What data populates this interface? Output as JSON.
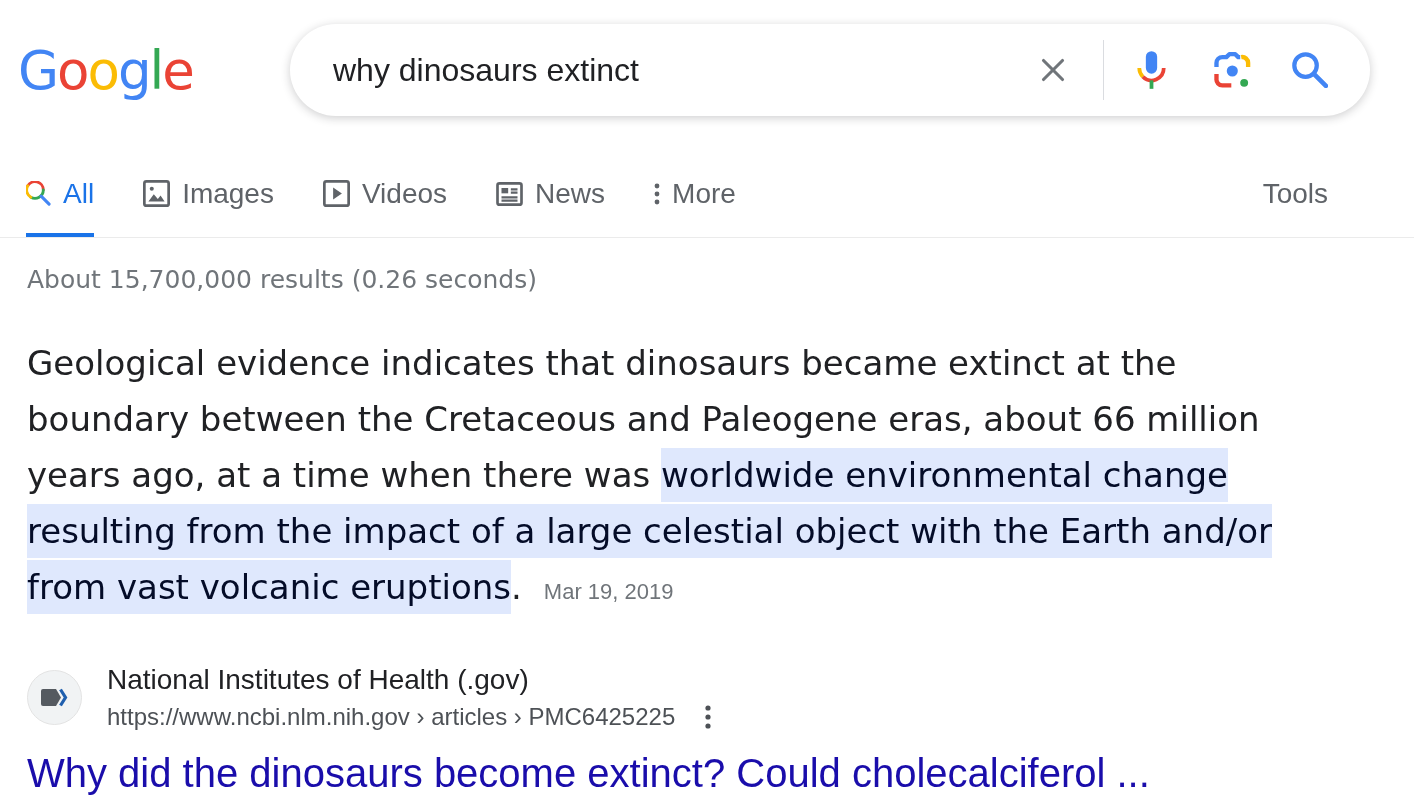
{
  "logo": {
    "text": "Google"
  },
  "search": {
    "value": "why dinosaurs extinct"
  },
  "tabs": [
    {
      "label": "All",
      "selected": true
    },
    {
      "label": "Images",
      "selected": false
    },
    {
      "label": "Videos",
      "selected": false
    },
    {
      "label": "News",
      "selected": false
    },
    {
      "label": "More",
      "selected": false
    }
  ],
  "tools": {
    "label": "Tools"
  },
  "result_stats": "About 15,700,000 results (0.26 seconds)",
  "featured_snippet": {
    "segments": [
      {
        "text": "Geological evidence indicates that dinosaurs became extinct at the boundary between the Cretaceous and Paleogene eras, about 66 million years ago, at a time when there was ",
        "highlighted": false
      },
      {
        "text": "worldwide environmental change resulting from the impact of a large celestial object with the Earth and/or from vast volcanic eruptions",
        "highlighted": true
      },
      {
        "text": ".",
        "highlighted": false
      }
    ],
    "date": "Mar 19, 2019",
    "source": {
      "name": "National Institutes of Health (.gov)",
      "url": "https://www.ncbi.nlm.nih.gov › articles › PMC6425225"
    },
    "title": "Why did the dinosaurs become extinct? Could cholecalciferol ..."
  }
}
